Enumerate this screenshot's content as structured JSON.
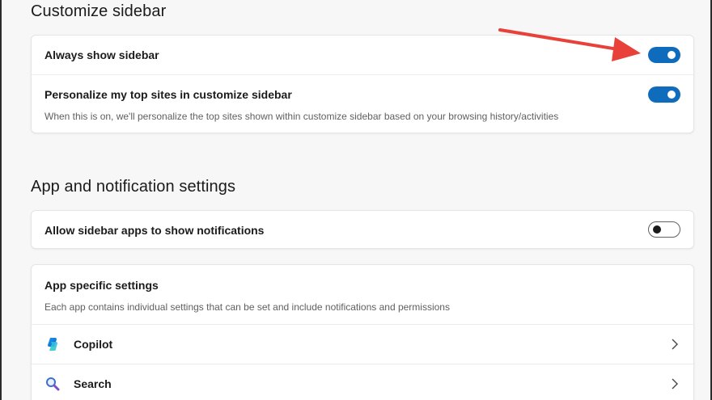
{
  "customize_sidebar": {
    "title": "Customize sidebar",
    "always_show": {
      "label": "Always show sidebar",
      "state": "on"
    },
    "personalize": {
      "label": "Personalize my top sites in customize sidebar",
      "description": "When this is on, we'll personalize the top sites shown within customize sidebar based on your browsing history/activities",
      "state": "on"
    }
  },
  "app_notification": {
    "title": "App and notification settings",
    "allow_notifications": {
      "label": "Allow sidebar apps to show notifications",
      "state": "off"
    },
    "app_specific": {
      "label": "App specific settings",
      "description": "Each app contains individual settings that can be set and include notifications and permissions",
      "apps": [
        {
          "label": "Copilot",
          "icon": "copilot-icon"
        },
        {
          "label": "Search",
          "icon": "search-icon"
        }
      ]
    }
  },
  "colors": {
    "accent": "#0f6cbd",
    "annotation_arrow": "#e8413a"
  }
}
